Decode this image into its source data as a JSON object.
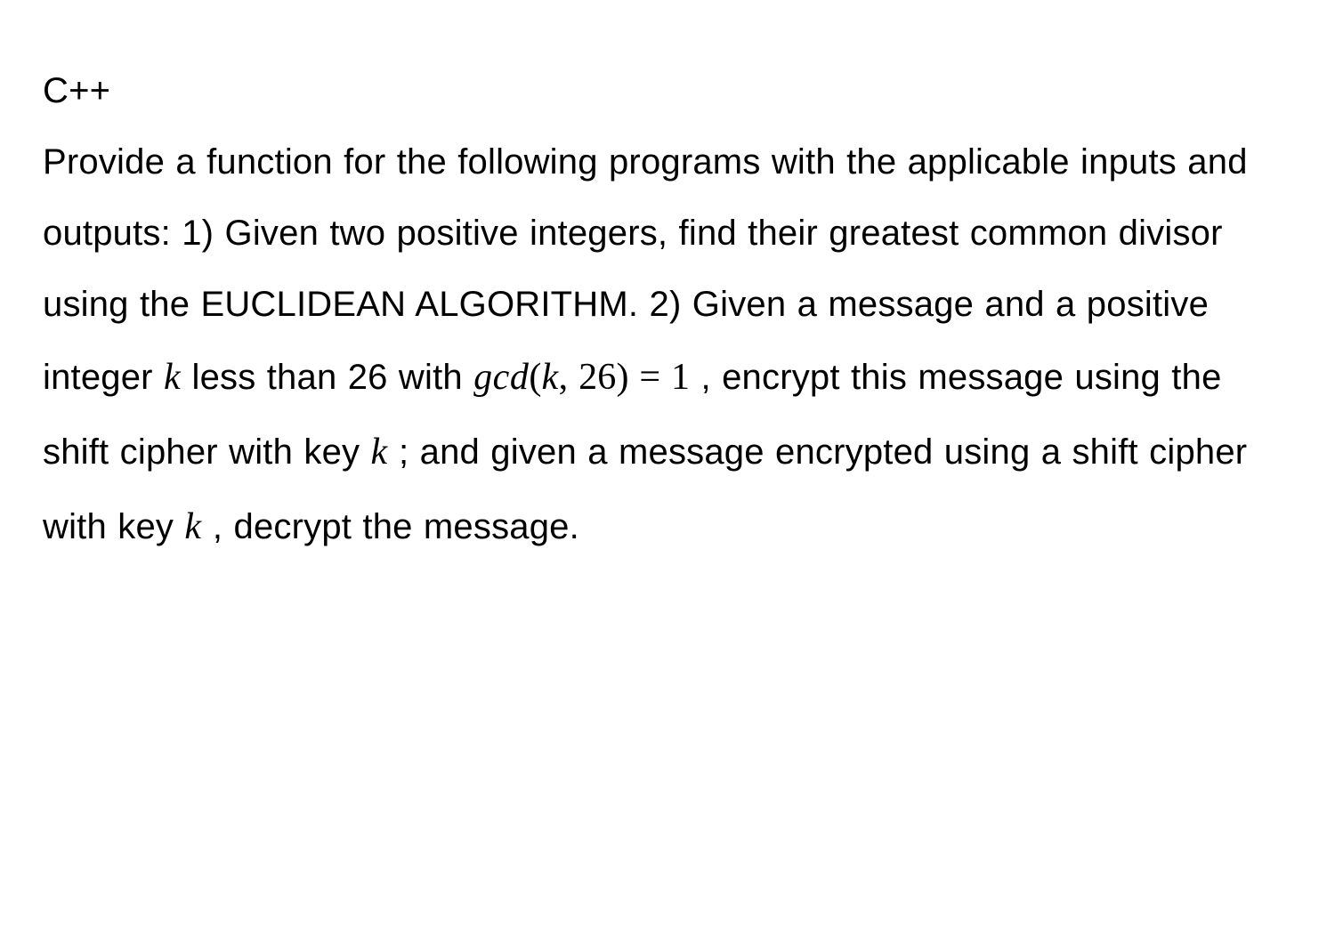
{
  "heading": "C++",
  "p1a": "Provide a function for the following programs with the applicable inputs and outputs: 1) Given two positive integers, find their greatest common divisor using the EUCLIDEAN ALGORITHM. 2) Given a message and a positive integer ",
  "k1": "k",
  "p1b": " less than 26 with ",
  "gcd_fn": "gcd",
  "gcd_open": "(",
  "gcd_k": "k",
  "gcd_comma": ", ",
  "gcd_26": "26",
  "gcd_close": ")",
  "gcd_eq": " = ",
  "gcd_one": "1",
  "p1c": " , encrypt this message using the shift cipher with key ",
  "k2": "k",
  "p1d": " ; and given a message encrypted using a shift cipher with key ",
  "k3": "k",
  "p1e": " , decrypt the message."
}
